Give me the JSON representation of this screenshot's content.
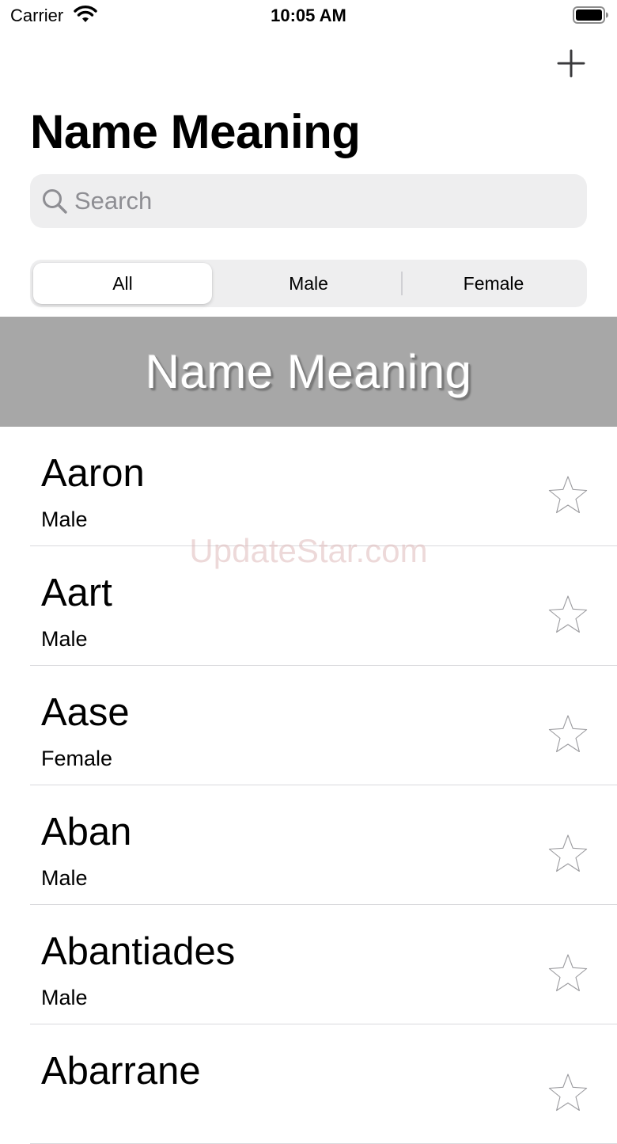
{
  "status_bar": {
    "carrier": "Carrier",
    "time": "10:05 AM",
    "icons": [
      "wifi-icon",
      "battery-icon"
    ]
  },
  "nav": {
    "add_icon": "plus-icon",
    "title": "Name Meaning"
  },
  "search": {
    "placeholder": "Search",
    "value": "",
    "icon": "search-icon"
  },
  "segments": [
    {
      "label": "All",
      "selected": true
    },
    {
      "label": "Male",
      "selected": false
    },
    {
      "label": "Female",
      "selected": false
    }
  ],
  "banner": {
    "text": "Name Meaning"
  },
  "names": [
    {
      "name": "Aaron",
      "gender": "Male",
      "favorite": false
    },
    {
      "name": "Aart",
      "gender": "Male",
      "favorite": false
    },
    {
      "name": "Aase",
      "gender": "Female",
      "favorite": false
    },
    {
      "name": "Aban",
      "gender": "Male",
      "favorite": false
    },
    {
      "name": "Abantiades",
      "gender": "Male",
      "favorite": false
    },
    {
      "name": "Abarrane",
      "gender": "",
      "favorite": false
    }
  ],
  "watermark": "UpdateStar.com",
  "colors": {
    "background": "#ffffff",
    "search_bg": "#eeeeef",
    "placeholder": "#8e8e93",
    "banner_bg": "#a7a7a7",
    "separator": "#d9d9dc"
  }
}
